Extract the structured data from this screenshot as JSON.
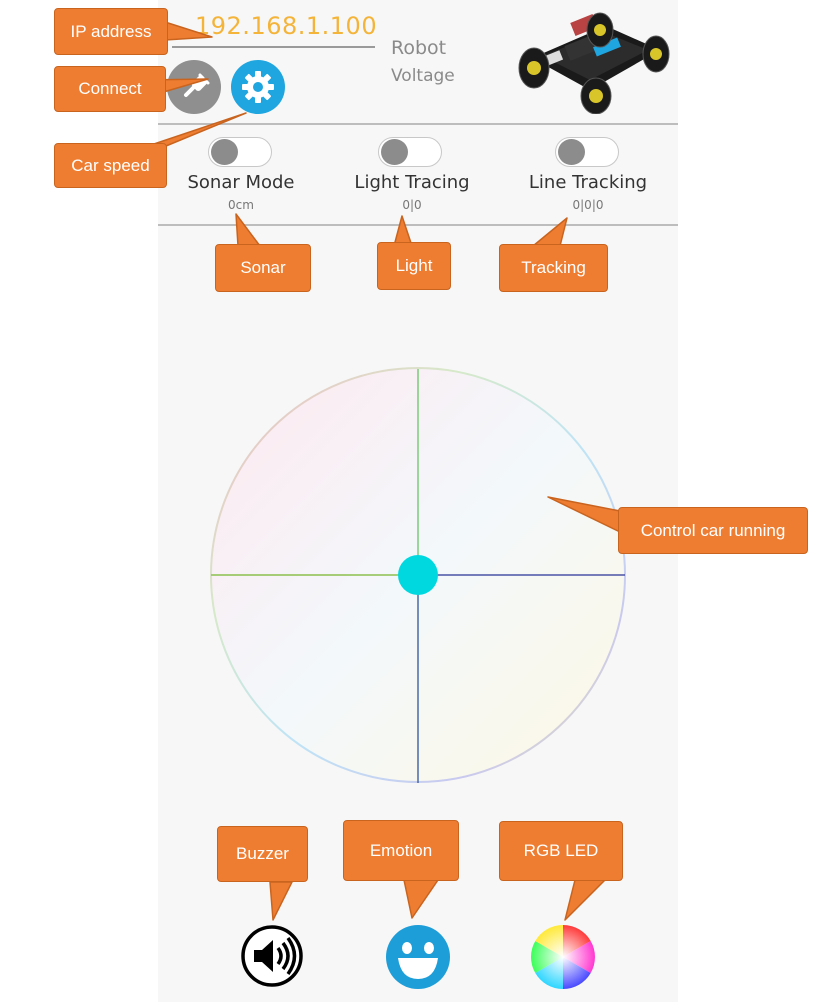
{
  "header": {
    "ip_address": "192.168.1.100",
    "robot_label": "Robot",
    "voltage_label": "Voltage"
  },
  "buttons": {
    "connect_icon": "plug-icon",
    "speed_icon": "gear-icon"
  },
  "modes": [
    {
      "label": "Sonar Mode",
      "value": "0cm",
      "enabled": false
    },
    {
      "label": "Light Tracing",
      "value": "0|0",
      "enabled": false
    },
    {
      "label": "Line Tracking",
      "value": "0|0|0",
      "enabled": false
    }
  ],
  "callouts": {
    "ip_address": "IP address",
    "connect": "Connect",
    "car_speed": "Car speed",
    "sonar": "Sonar",
    "light": "Light",
    "tracking": "Tracking",
    "control": "Control car running",
    "buzzer": "Buzzer",
    "emotion": "Emotion",
    "rgb_led": "RGB LED"
  },
  "bottom_icons": [
    "speaker-icon",
    "smiley-icon",
    "color-wheel-icon"
  ],
  "colors": {
    "accent": "#1fa5df",
    "ip_text": "#f4b43a",
    "callout": "#ee7d31",
    "joystick_knob": "#00d8e0"
  }
}
